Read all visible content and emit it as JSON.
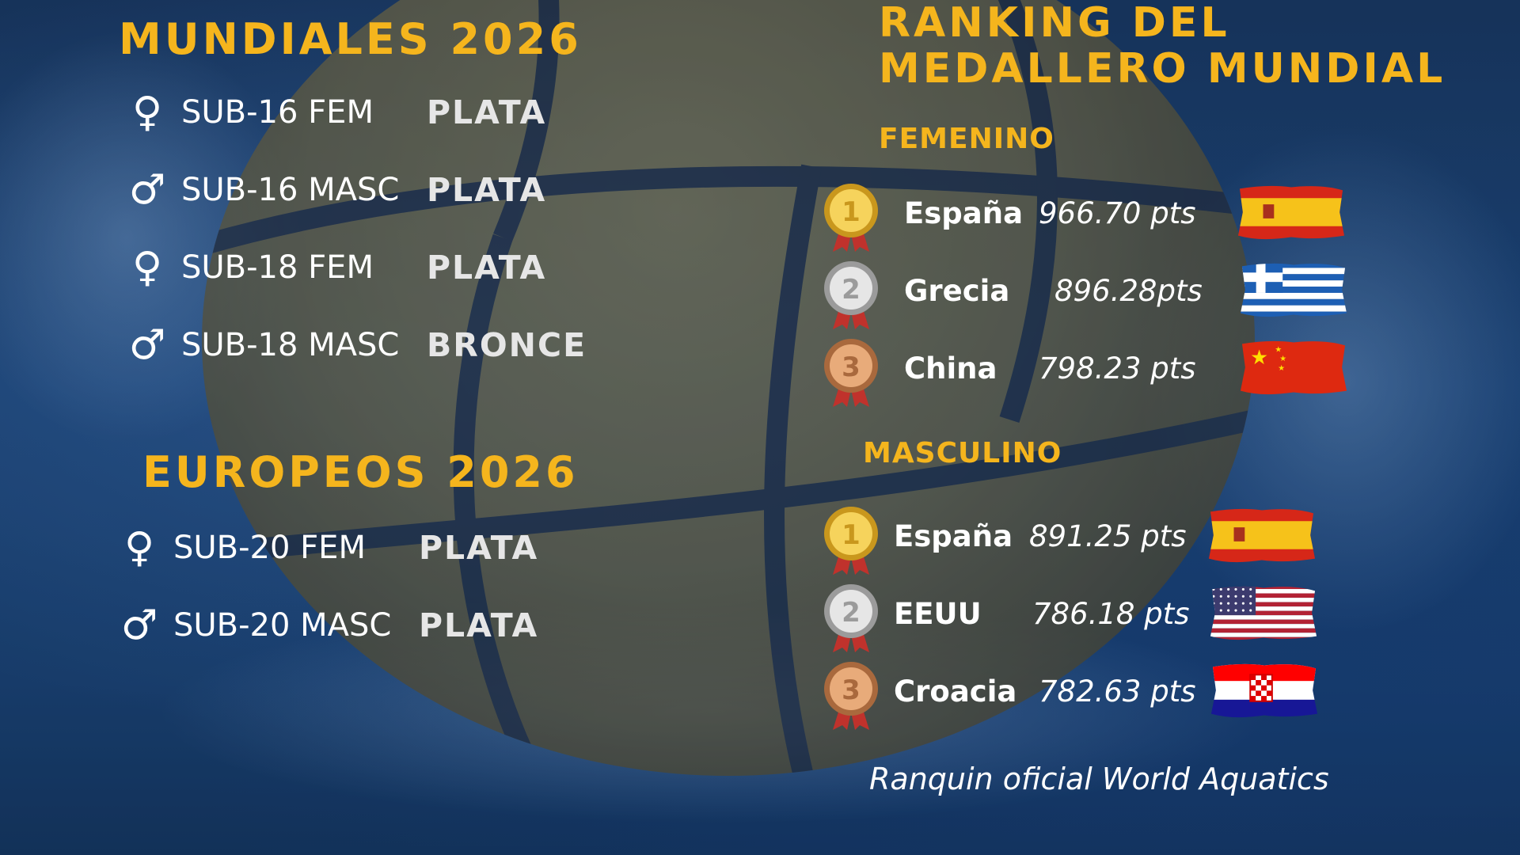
{
  "mundiales": {
    "title": "MUNDIALES 2026",
    "rows": [
      {
        "symbol": "♀",
        "category": "SUB-16 FEM",
        "result": "PLATA"
      },
      {
        "symbol": "♂",
        "category": "SUB-16 MASC",
        "result": "PLATA"
      },
      {
        "symbol": "♀",
        "category": "SUB-18 FEM",
        "result": "PLATA"
      },
      {
        "symbol": "♂",
        "category": "SUB-18 MASC",
        "result": "BRONCE"
      }
    ]
  },
  "europeos": {
    "title": "EUROPEOS 2026",
    "rows": [
      {
        "symbol": "♀",
        "category": "SUB-20 FEM",
        "result": "PLATA"
      },
      {
        "symbol": "♂",
        "category": "SUB-20 MASC",
        "result": "PLATA"
      }
    ]
  },
  "ranking": {
    "title_line1": "RANKING DEL",
    "title_line2": "MEDALLERO MUNDIAL",
    "femenino": {
      "title": "FEMENINO",
      "entries": [
        {
          "place": "1",
          "country": "España",
          "points": "966.70 pts",
          "flag": "spain-flag"
        },
        {
          "place": "2",
          "country": "Grecia",
          "points": "896.28pts",
          "flag": "greece-flag"
        },
        {
          "place": "3",
          "country": "China",
          "points": "798.23 pts",
          "flag": "china-flag"
        }
      ]
    },
    "masculino": {
      "title": "MASCULINO",
      "entries": [
        {
          "place": "1",
          "country": "España",
          "points": "891.25 pts",
          "flag": "spain-flag"
        },
        {
          "place": "2",
          "country": "EEUU",
          "points": "786.18 pts",
          "flag": "usa-flag"
        },
        {
          "place": "3",
          "country": "Croacia",
          "points": "782.63 pts",
          "flag": "croatia-flag"
        }
      ]
    },
    "note": "Ranquin oficial World Aquatics"
  },
  "colors": {
    "accent": "#f5b51d",
    "gold": "#e3b53a",
    "silver": "#c9c9c9",
    "bronze": "#c98b5a",
    "ribbon": "#c0322c"
  }
}
